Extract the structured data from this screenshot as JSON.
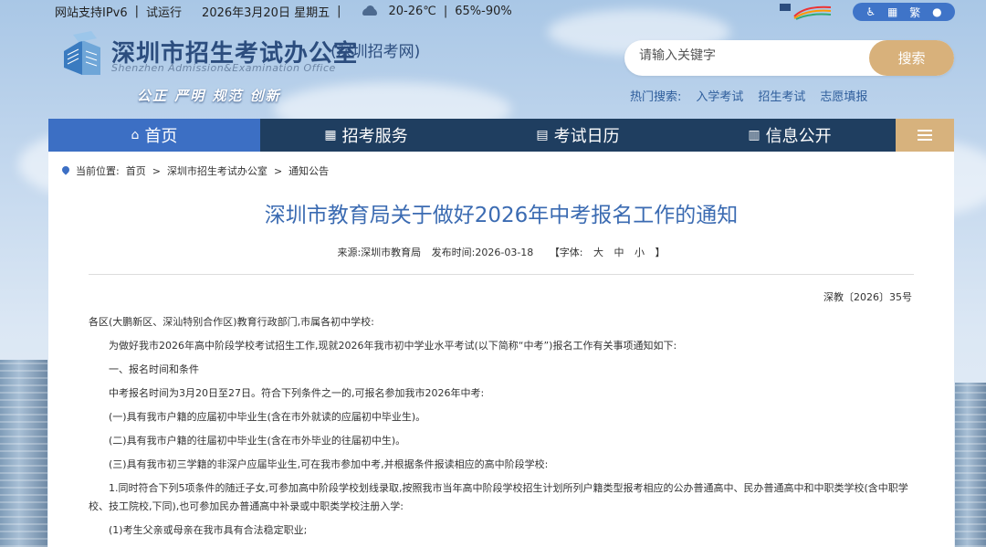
{
  "topbar": {
    "ipv6": "网站支持IPv6",
    "trial": "试运行",
    "date": "2026年3月20日 星期五",
    "temp": "20-26℃",
    "humidity": "65%-90%"
  },
  "header": {
    "title": "深圳市招生考试办公室",
    "subtitle": "(深圳招考网)",
    "english": "Shenzhen Admission&Examination Office",
    "slogan": "公正 严明 规范 创新"
  },
  "access": {
    "accessible": "♿",
    "stats": "▦",
    "traditional": "繁",
    "wechat": "●"
  },
  "search": {
    "placeholder": "请输入关键字",
    "button": "搜索",
    "hot_label": "热门搜索:",
    "hot_items": [
      "入学考试",
      "招生考试",
      "志愿填报"
    ]
  },
  "nav": {
    "items": [
      "首页",
      "招考服务",
      "考试日历",
      "信息公开"
    ]
  },
  "breadcrumb": {
    "label": "当前位置:",
    "items": [
      "首页",
      "深圳市招生考试办公室",
      "通知公告"
    ],
    "sep": ">"
  },
  "article": {
    "title": "深圳市教育局关于做好2026年中考报名工作的通知",
    "source": "来源:深圳市教育局",
    "published": "发布时间:2026-03-18",
    "font_label": "【字体:",
    "font_large": "大",
    "font_medium": "中",
    "font_small": "小",
    "font_end": "】",
    "doc_no": "深教〔2026〕35号",
    "paragraphs": [
      "各区(大鹏新区、深汕特别合作区)教育行政部门,市属各初中学校:",
      "为做好我市2026年高中阶段学校考试招生工作,现就2026年我市初中学业水平考试(以下简称“中考”)报名工作有关事项通知如下:",
      "一、报名时间和条件",
      "中考报名时间为3月20日至27日。符合下列条件之一的,可报名参加我市2026年中考:",
      "(一)具有我市户籍的应届初中毕业生(含在市外就读的应届初中毕业生)。",
      "(二)具有我市户籍的往届初中毕业生(含在市外毕业的往届初中生)。",
      "(三)具有我市初三学籍的非深户应届毕业生,可在我市参加中考,并根据条件报读相应的高中阶段学校:",
      "1.同时符合下列5项条件的随迁子女,可参加高中阶段学校划线录取,按照我市当年高中阶段学校招生计划所列户籍类型报考相应的公办普通高中、民办普通高中和中职类学校(含中职学校、技工院校,下同),也可参加民办普通高中补录或中职类学校注册入学:",
      "(1)考生父亲或母亲在我市具有合法稳定职业;"
    ]
  }
}
